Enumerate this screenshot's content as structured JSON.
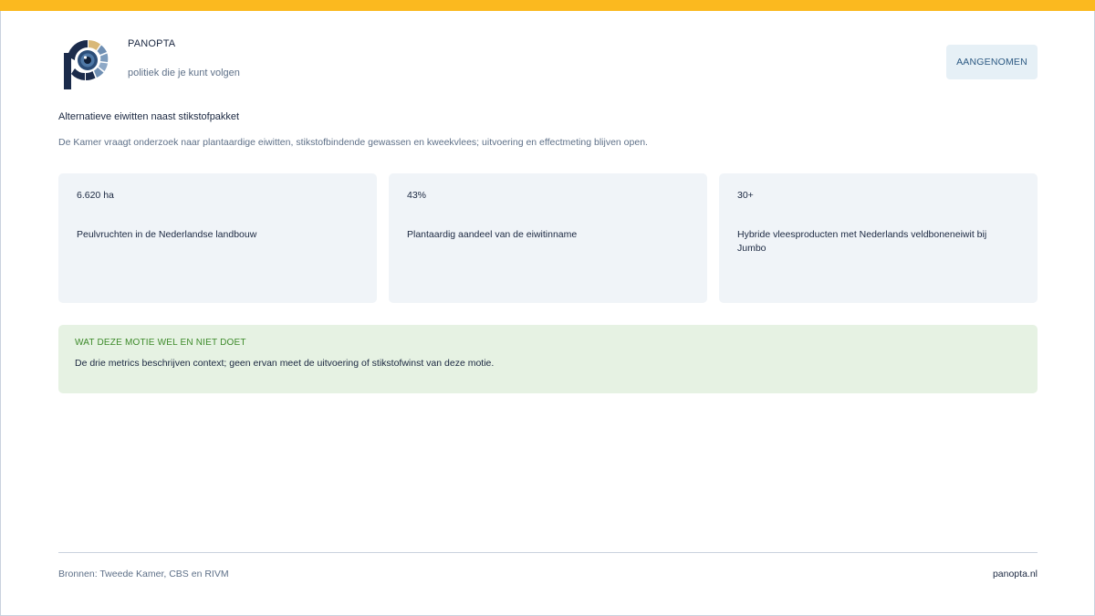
{
  "brand": {
    "name": "PANOPTA",
    "tagline": "politiek die je kunt volgen",
    "logo_icon": "panopta-eye-logo-icon",
    "colors": {
      "accent_bar": "#fbb91f",
      "logo_dark": "#1b2b4b",
      "logo_gold": "#d9b877",
      "logo_blue": "#6f8fb3"
    }
  },
  "status": {
    "label": "AANGENOMEN"
  },
  "motion": {
    "title": "Alternatieve eiwitten naast stikstofpakket",
    "summary": "De Kamer vraagt onderzoek naar plantaardige eiwitten, stikstofbindende gewassen en kweekvlees; uitvoering en effectmeting blijven open."
  },
  "metrics": [
    {
      "value": "6.620 ha",
      "label": "Peulvruchten in de Nederlandse landbouw"
    },
    {
      "value": "43%",
      "label": "Plantaardig aandeel van de eiwitinname"
    },
    {
      "value": "30+",
      "label": "Hybride vleesproducten met Nederlands veldboneneiwit bij Jumbo"
    }
  ],
  "note": {
    "heading": "WAT DEZE MOTIE WEL EN NIET DOET",
    "text": "De drie metrics beschrijven context; geen ervan meet de uitvoering of stikstofwinst van deze motie."
  },
  "footer": {
    "sources": "Bronnen: Tweede Kamer, CBS en RIVM",
    "site": "panopta.nl"
  }
}
